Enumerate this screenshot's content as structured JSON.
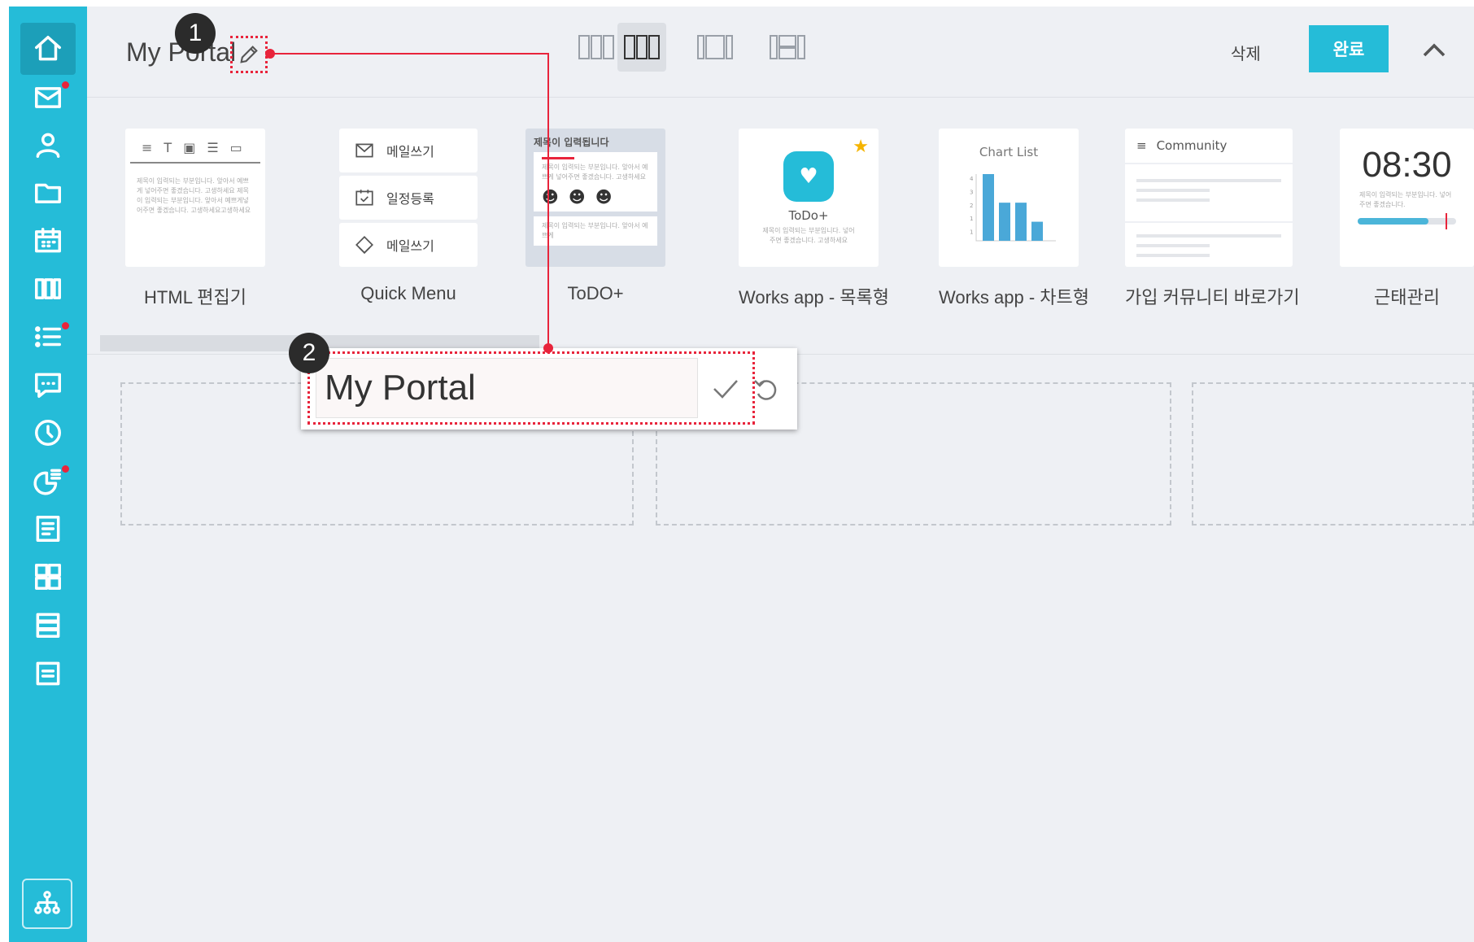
{
  "sidebar": {
    "items": [
      {
        "icon": "home-icon",
        "active": true
      },
      {
        "icon": "mail-icon",
        "notification": true
      },
      {
        "icon": "user-icon"
      },
      {
        "icon": "folder-icon"
      },
      {
        "icon": "calendar-icon"
      },
      {
        "icon": "columns-icon"
      },
      {
        "icon": "list-icon",
        "notification": true
      },
      {
        "icon": "chat-icon"
      },
      {
        "icon": "clock-icon"
      },
      {
        "icon": "chart-icon",
        "notification": true
      },
      {
        "icon": "document-icon"
      },
      {
        "icon": "grid-icon"
      },
      {
        "icon": "stack-icon"
      },
      {
        "icon": "note-icon"
      }
    ],
    "bottom_icon": "org-chart-icon"
  },
  "header": {
    "title": "My Portal",
    "badge_1": "1",
    "layout_options": [
      "layout-3-equal",
      "layout-3-equal-selected",
      "layout-wide-center",
      "layout-mixed"
    ],
    "delete_label": "삭제",
    "done_label": "완료"
  },
  "widgets": [
    {
      "label": "HTML 편집기",
      "preview_text": "제목이 입력되는 부분입니다. 앞아서 예쁘게 넣어주면 좋겠습니다. 고생하세요 제목이 입력되는 부분입니다. 앞아서 예쁘게넣어주면 좋겠습니다. 고생하세요고생하세요"
    },
    {
      "label": "Quick Menu",
      "items": [
        "메일쓰기",
        "일정등록",
        "메일쓰기"
      ]
    },
    {
      "label": "ToDO+",
      "heading": "제목이 입력됩니다",
      "line_1": "제목이 입력되는 부분입니다. 앞아서 예쁘게 넣어주면 좋겠습니다. 고생하세요",
      "line_2": "제목이 입력되는 부분입니다. 앞아서 예쁘게"
    },
    {
      "label": "Works app - 목록형",
      "app_name": "ToDo+",
      "app_desc": "제목이 입력되는 부분입니다. 넣어주면 좋겠습니다. 고생하세요"
    },
    {
      "label": "Works app - 차트형",
      "chart_title": "Chart List",
      "bar_values": [
        7,
        4,
        4,
        2
      ],
      "y_ticks": [
        "4",
        "3",
        "2",
        "1",
        "1"
      ]
    },
    {
      "label": "가입 커뮤니티 바로가기",
      "heading": "Community"
    },
    {
      "label": "근태관리",
      "time": "08:30",
      "desc": "제목이 입력되는 부분입니다. 넣어주면 좋겠습니다.",
      "progress": 0.72
    }
  ],
  "popup": {
    "badge_2": "2",
    "input_value": "My Portal"
  },
  "colors": {
    "accent": "#25bcd8",
    "highlight": "#e8243b"
  }
}
